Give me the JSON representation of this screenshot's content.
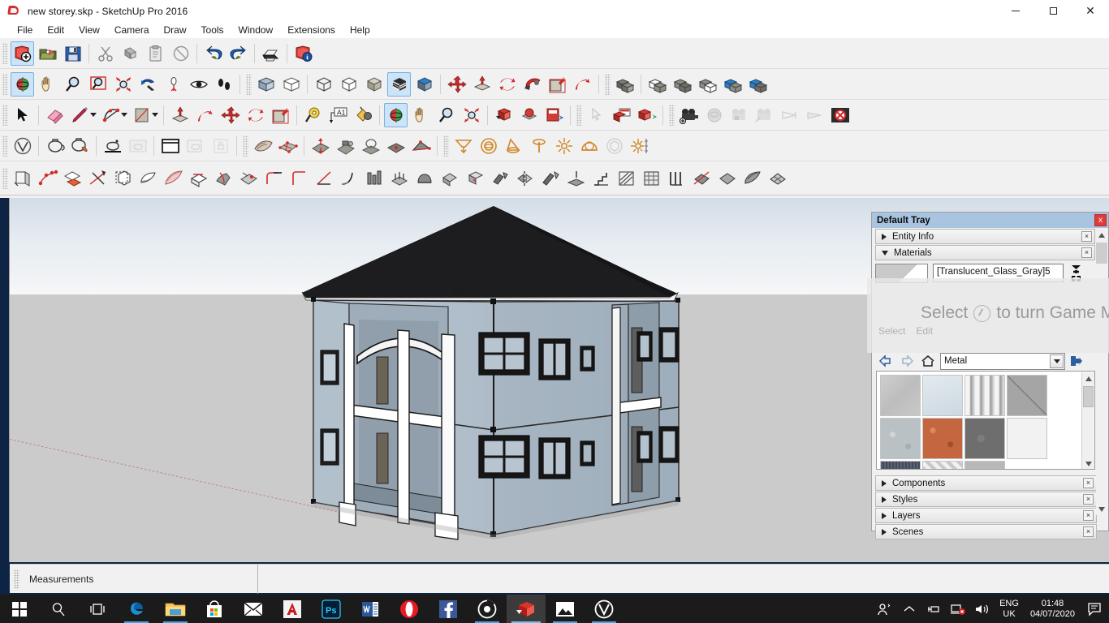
{
  "window": {
    "title": "new storey.skp - SketchUp Pro 2016",
    "app_icon": "sketchup-logo-icon",
    "minimize": "minimize-icon",
    "maximize": "maximize-icon",
    "close": "close-icon"
  },
  "menu": {
    "items": [
      {
        "label": "File"
      },
      {
        "label": "Edit"
      },
      {
        "label": "View"
      },
      {
        "label": "Camera"
      },
      {
        "label": "Draw"
      },
      {
        "label": "Tools"
      },
      {
        "label": "Window"
      },
      {
        "label": "Extensions"
      },
      {
        "label": "Help"
      }
    ]
  },
  "toolbars": {
    "standard": [
      {
        "name": "new-document-icon",
        "tooltip": "New"
      },
      {
        "name": "open-folder-icon",
        "tooltip": "Open"
      },
      {
        "name": "save-floppy-icon",
        "tooltip": "Save"
      },
      {
        "name": "cut-scissors-icon",
        "tooltip": "Cut"
      },
      {
        "name": "copy-icon",
        "tooltip": "Copy"
      },
      {
        "name": "paste-icon",
        "tooltip": "Paste"
      },
      {
        "name": "erase-circle-icon",
        "tooltip": "Erase"
      },
      {
        "name": "undo-arrow-icon",
        "tooltip": "Undo"
      },
      {
        "name": "redo-arrow-icon",
        "tooltip": "Redo"
      },
      {
        "name": "printer-icon",
        "tooltip": "Print"
      },
      {
        "name": "model-info-icon",
        "tooltip": "Model Info"
      }
    ],
    "camera": [
      {
        "name": "orbit-icon",
        "tooltip": "Orbit",
        "selected": true
      },
      {
        "name": "pan-hand-icon",
        "tooltip": "Pan"
      },
      {
        "name": "zoom-magnifier-icon",
        "tooltip": "Zoom"
      },
      {
        "name": "zoom-window-icon",
        "tooltip": "Zoom Window"
      },
      {
        "name": "zoom-extents-icon",
        "tooltip": "Zoom Extents"
      },
      {
        "name": "previous-view-icon",
        "tooltip": "Previous"
      },
      {
        "name": "position-camera-icon",
        "tooltip": "Position Camera"
      },
      {
        "name": "look-around-eye-icon",
        "tooltip": "Look Around"
      },
      {
        "name": "walk-footsteps-icon",
        "tooltip": "Walk"
      }
    ],
    "styles": [
      {
        "name": "xray-face-icon",
        "tooltip": "X-ray"
      },
      {
        "name": "back-edges-icon",
        "tooltip": "Back Edges"
      },
      {
        "name": "wireframe-icon",
        "tooltip": "Wireframe"
      },
      {
        "name": "hidden-line-icon",
        "tooltip": "Hidden Line"
      },
      {
        "name": "shaded-icon",
        "tooltip": "Shaded"
      },
      {
        "name": "shaded-textures-icon",
        "tooltip": "Shaded With Textures",
        "selected": true
      },
      {
        "name": "monochrome-icon",
        "tooltip": "Monochrome"
      }
    ],
    "modify": [
      {
        "name": "move-icon",
        "tooltip": "Move"
      },
      {
        "name": "push-pull-icon",
        "tooltip": "Push/Pull"
      },
      {
        "name": "rotate-icon",
        "tooltip": "Rotate"
      },
      {
        "name": "follow-me-icon",
        "tooltip": "Follow Me"
      },
      {
        "name": "scale-icon",
        "tooltip": "Scale"
      },
      {
        "name": "offset-icon",
        "tooltip": "Offset"
      }
    ],
    "solid_tools": [
      {
        "name": "outer-shell-icon",
        "tooltip": "Outer Shell"
      },
      {
        "name": "intersect-solid-icon",
        "tooltip": "Intersect"
      },
      {
        "name": "union-solid-icon",
        "tooltip": "Union"
      },
      {
        "name": "subtract-solid-icon",
        "tooltip": "Subtract"
      },
      {
        "name": "trim-solid-icon",
        "tooltip": "Trim"
      },
      {
        "name": "split-solid-icon",
        "tooltip": "Split"
      }
    ],
    "large_tools": [
      {
        "name": "select-arrow-icon",
        "tooltip": "Select"
      },
      {
        "name": "eraser-icon",
        "tooltip": "Eraser"
      },
      {
        "name": "line-pencil-icon",
        "tooltip": "Line",
        "dropdown": true
      },
      {
        "name": "arc-icon",
        "tooltip": "Arc",
        "dropdown": true
      },
      {
        "name": "rectangle-icon",
        "tooltip": "Rectangle",
        "dropdown": true
      },
      {
        "name": "push-pull-icon",
        "tooltip": "Push/Pull"
      },
      {
        "name": "offset-icon",
        "tooltip": "Offset"
      },
      {
        "name": "move-icon",
        "tooltip": "Move"
      },
      {
        "name": "rotate-icon",
        "tooltip": "Rotate"
      },
      {
        "name": "scale-icon",
        "tooltip": "Scale"
      },
      {
        "name": "tape-measure-icon",
        "tooltip": "Tape Measure"
      },
      {
        "name": "text-tool-icon",
        "tooltip": "Text"
      },
      {
        "name": "paint-bucket-icon",
        "tooltip": "Paint Bucket"
      },
      {
        "name": "orbit-icon",
        "tooltip": "Orbit",
        "selected": true
      },
      {
        "name": "pan-hand-icon",
        "tooltip": "Pan"
      },
      {
        "name": "zoom-magnifier-icon",
        "tooltip": "Zoom"
      },
      {
        "name": "zoom-extents-icon",
        "tooltip": "Zoom Extents"
      }
    ],
    "warehouse": [
      {
        "name": "3d-warehouse-icon",
        "tooltip": "3D Warehouse"
      },
      {
        "name": "share-model-icon",
        "tooltip": "Share Model"
      },
      {
        "name": "extension-warehouse-icon",
        "tooltip": "Extension Warehouse"
      },
      {
        "name": "layout-select-icon",
        "tooltip": "LayOut"
      },
      {
        "name": "send-to-layout-icon",
        "tooltip": "Send to LayOut"
      },
      {
        "name": "export-model-icon",
        "tooltip": "Export"
      }
    ],
    "vray_camera": [
      {
        "name": "vray-camera-add-icon",
        "tooltip": "Add Camera"
      },
      {
        "name": "vray-lens-icon",
        "tooltip": "Lens",
        "disabled": true
      },
      {
        "name": "vray-camera-lock-icon",
        "tooltip": "Lock Camera",
        "disabled": true
      },
      {
        "name": "vray-camera-edit-icon",
        "tooltip": "Edit Camera",
        "disabled": true
      },
      {
        "name": "frustum-icon",
        "tooltip": "Frustum",
        "disabled": true
      },
      {
        "name": "frustum-alt-icon",
        "tooltip": "Frustum Alt",
        "disabled": true
      },
      {
        "name": "vray-cancel-icon",
        "tooltip": "Cancel Render"
      }
    ],
    "vray": [
      {
        "name": "vray-logo-icon",
        "tooltip": "V-Ray"
      },
      {
        "name": "material-editor-teapot-icon",
        "tooltip": "Material Editor"
      },
      {
        "name": "material-picker-icon",
        "tooltip": "Material Picker"
      },
      {
        "name": "render-icon",
        "tooltip": "Render"
      },
      {
        "name": "render-preview-icon",
        "tooltip": "Render Preview",
        "disabled": true
      },
      {
        "name": "frame-buffer-icon",
        "tooltip": "Frame Buffer"
      },
      {
        "name": "render-region-icon",
        "tooltip": "Render Region",
        "disabled": true
      },
      {
        "name": "lock-render-icon",
        "tooltip": "Lock",
        "disabled": true
      }
    ],
    "sandbox": [
      {
        "name": "from-contours-icon",
        "tooltip": "From Contours"
      },
      {
        "name": "from-scratch-icon",
        "tooltip": "From Scratch"
      },
      {
        "name": "smoove-icon",
        "tooltip": "Smoove"
      },
      {
        "name": "stamp-icon",
        "tooltip": "Stamp"
      },
      {
        "name": "drape-icon",
        "tooltip": "Drape"
      },
      {
        "name": "add-detail-icon",
        "tooltip": "Add Detail"
      },
      {
        "name": "flip-edge-icon",
        "tooltip": "Flip Edge"
      }
    ],
    "vray_lights": [
      {
        "name": "rectangle-light-icon",
        "tooltip": "Rectangle Light"
      },
      {
        "name": "sphere-light-icon",
        "tooltip": "Sphere Light"
      },
      {
        "name": "spot-light-icon",
        "tooltip": "Spot Light"
      },
      {
        "name": "ies-light-icon",
        "tooltip": "IES Light"
      },
      {
        "name": "omni-light-icon",
        "tooltip": "Omni Light"
      },
      {
        "name": "dome-light-icon",
        "tooltip": "Dome Light"
      },
      {
        "name": "mesh-light-icon",
        "tooltip": "Mesh Light"
      },
      {
        "name": "sun-light-icon",
        "tooltip": "Sun Light"
      }
    ],
    "extensions_row": [
      {
        "name": "joint-push-pull-icon"
      },
      {
        "name": "bezier-curve-icon"
      },
      {
        "name": "fredo-scale-icon"
      },
      {
        "name": "intersect-line-icon"
      },
      {
        "name": "round-corner-icon"
      },
      {
        "name": "curviloft-icon"
      },
      {
        "name": "curviloft-skin-icon"
      },
      {
        "name": "extrude-tools-icon"
      },
      {
        "name": "shape-bender-icon"
      },
      {
        "name": "vertex-tools-icon"
      },
      {
        "name": "fillet-corner-icon"
      },
      {
        "name": "corner-tool-icon"
      },
      {
        "name": "taper-tool-icon"
      },
      {
        "name": "curve-tool-icon"
      },
      {
        "name": "pipe-tool-icon"
      },
      {
        "name": "slicer-icon"
      },
      {
        "name": "profile-builder-icon"
      },
      {
        "name": "follow-path-icon"
      },
      {
        "name": "solid-inspector-icon"
      },
      {
        "name": "cleanup-icon"
      },
      {
        "name": "mirror-tool-icon"
      },
      {
        "name": "weld-tool-icon"
      },
      {
        "name": "flatten-icon"
      },
      {
        "name": "stair-maker-icon"
      },
      {
        "name": "hatch-faces-icon"
      },
      {
        "name": "texture-tool-icon"
      },
      {
        "name": "wall-tool-icon"
      },
      {
        "name": "zorro-slice-icon"
      },
      {
        "name": "quad-face-icon"
      },
      {
        "name": "artisan-icon"
      },
      {
        "name": "subdivide-icon"
      }
    ]
  },
  "viewport": {
    "model_name": "two-storey-residential-house",
    "sky_color": "#dce4ec",
    "ground_color": "#cbcbcb",
    "axis_color": "#c08080",
    "roof_color": "#1a1a1a",
    "wall_color": "#b4c2cd",
    "trim_color": "#ffffff"
  },
  "tray": {
    "title": "Default Tray",
    "close_label": "x",
    "panels": [
      {
        "label": "Entity Info",
        "expanded": false,
        "close_label": "×"
      },
      {
        "label": "Materials",
        "expanded": true,
        "close_label": "×"
      },
      {
        "label": "Components",
        "expanded": false,
        "close_label": "×"
      },
      {
        "label": "Styles",
        "expanded": false,
        "close_label": "×"
      },
      {
        "label": "Layers",
        "expanded": false,
        "close_label": "×"
      },
      {
        "label": "Scenes",
        "expanded": false,
        "close_label": "×"
      }
    ],
    "materials": {
      "current_name": "[Translucent_Glass_Gray]5",
      "create_material_icon": "create-material-icon",
      "back_icon": "back-arrow-icon",
      "forward_icon": "forward-arrow-icon",
      "home_icon": "home-icon",
      "details_icon": "details-arrow-icon",
      "library": "Metal",
      "library_options": [
        "Metal"
      ],
      "swatches": [
        {
          "name": "brushed-aluminum",
          "color": "#c2c2c2"
        },
        {
          "name": "galvanized-steel",
          "color": "#d5dde3"
        },
        {
          "name": "polished-metal-strip",
          "color": "#cfcfcf"
        },
        {
          "name": "metal-panel-diagonal",
          "color": "#8e8e8e"
        },
        {
          "name": "zinc-texture",
          "color": "#b9c1c4"
        },
        {
          "name": "rusted-copper",
          "color": "#c4663f"
        },
        {
          "name": "dark-steel",
          "color": "#6e6e6e"
        },
        {
          "name": "white-metal",
          "color": "#f2f2f2"
        },
        {
          "name": "dark-corrugated",
          "color": "#4e5566"
        },
        {
          "name": "diamond-plate",
          "color": "#dedede"
        },
        {
          "name": "light-aluminum",
          "color": "#b8b8b8"
        }
      ]
    }
  },
  "game_mode_overlay": {
    "message": "Select",
    "message_tail": "to turn Game M",
    "icon": "game-mode-icon",
    "sub_left": "Select",
    "sub_right": "Edit"
  },
  "status": {
    "measurements_label": "Measurements",
    "measurements_value": ""
  },
  "taskbar": {
    "items": [
      {
        "name": "start-button-icon",
        "label": "Start"
      },
      {
        "name": "search-icon",
        "label": "Search"
      },
      {
        "name": "task-view-icon",
        "label": "Task View"
      },
      {
        "name": "edge-browser-icon",
        "label": "Microsoft Edge",
        "running": true
      },
      {
        "name": "file-explorer-icon",
        "label": "File Explorer",
        "running": true
      },
      {
        "name": "microsoft-store-icon",
        "label": "Microsoft Store"
      },
      {
        "name": "mail-icon",
        "label": "Mail"
      },
      {
        "name": "autocad-icon",
        "label": "AutoCAD"
      },
      {
        "name": "photoshop-icon",
        "label": "Adobe Photoshop"
      },
      {
        "name": "word-icon",
        "label": "Microsoft Word"
      },
      {
        "name": "opera-browser-icon",
        "label": "Opera"
      },
      {
        "name": "facebook-icon",
        "label": "Facebook"
      },
      {
        "name": "target-circle-icon",
        "label": "App",
        "running": true
      },
      {
        "name": "sketchup-icon",
        "label": "SketchUp Pro 2016",
        "active": true
      },
      {
        "name": "photos-icon",
        "label": "Photos",
        "running": true
      },
      {
        "name": "vray-icon",
        "label": "V-Ray",
        "running": true
      }
    ],
    "system_tray": {
      "people_icon": "people-icon",
      "chevron_icon": "show-hidden-icons-chevron",
      "usb_icon": "usb-eject-icon",
      "network_icon": "network-disconnected-icon",
      "volume_icon": "speaker-icon",
      "language_line1": "ENG",
      "language_line2": "UK",
      "time": "01:48",
      "date": "04/07/2020",
      "action_center_icon": "action-center-icon"
    }
  }
}
